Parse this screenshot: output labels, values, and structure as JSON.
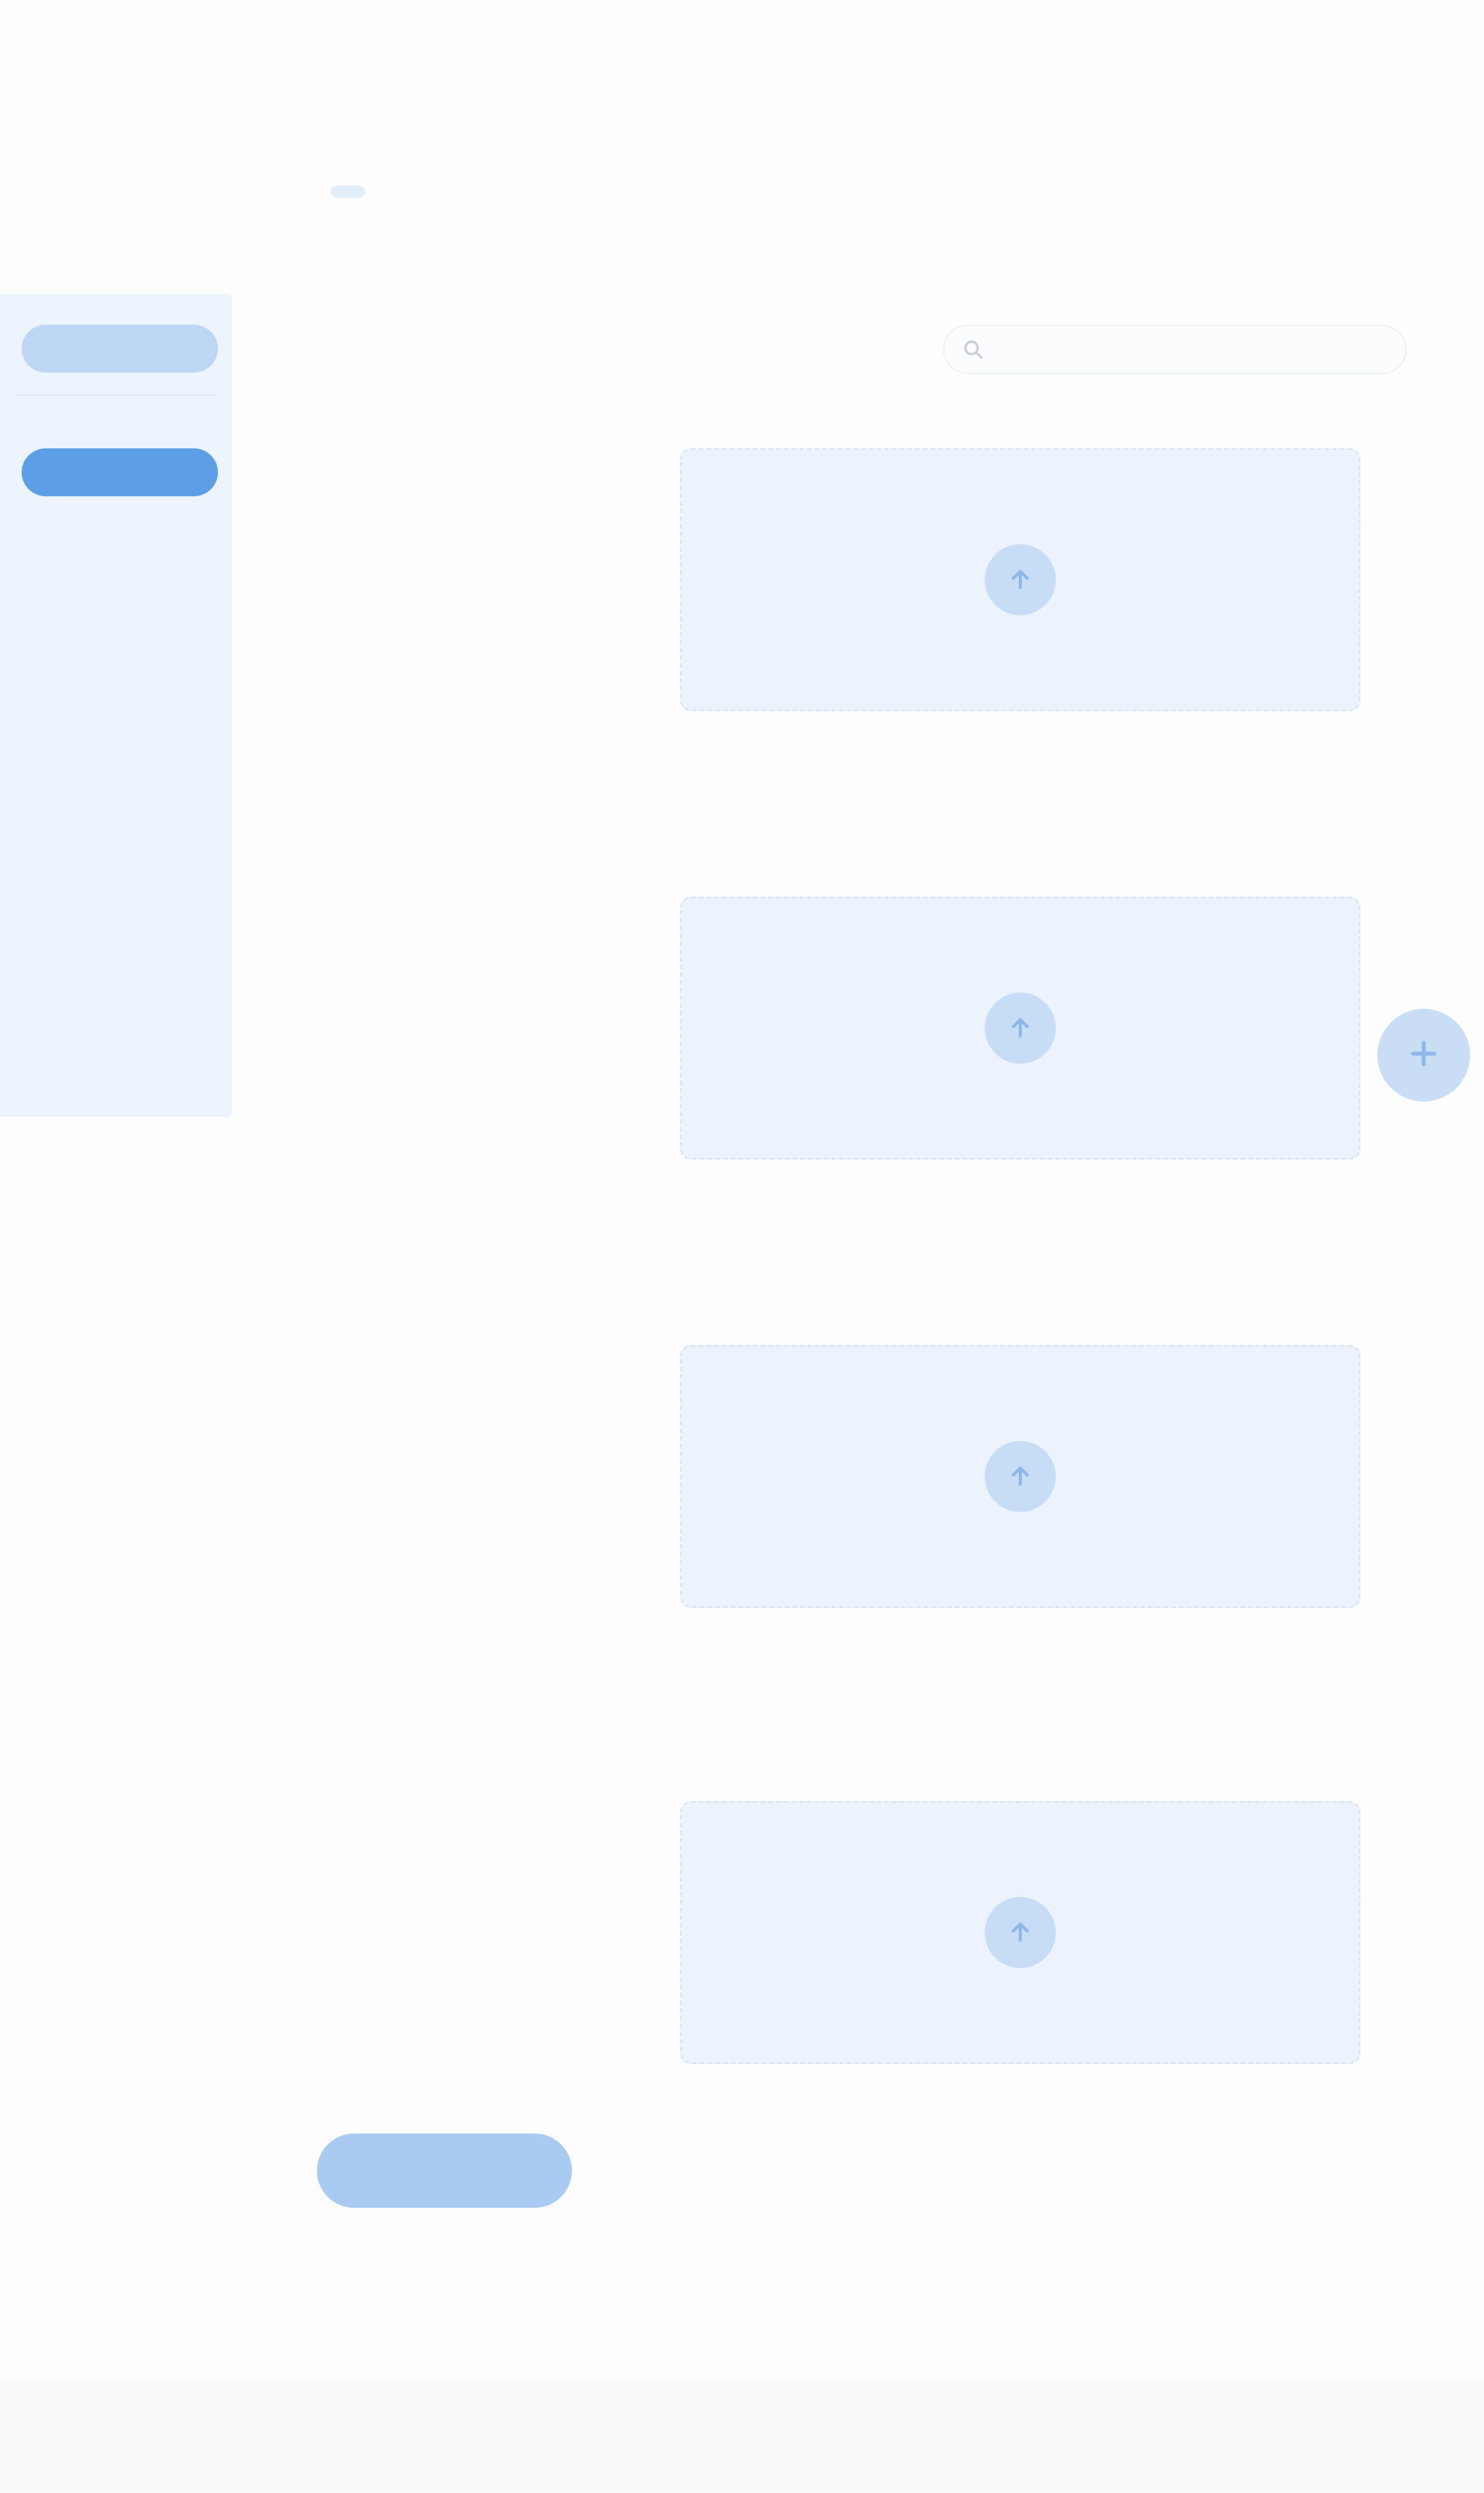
{
  "sidebar": {
    "tabs": [
      {
        "label": ""
      },
      {
        "label": ""
      }
    ],
    "items": [
      {
        "label": ""
      },
      {
        "label": ""
      },
      {
        "label": ""
      },
      {
        "label": ""
      },
      {
        "label": ""
      }
    ]
  },
  "header": {
    "title": "",
    "breadcrumbs": [
      {
        "label": ""
      },
      {
        "label": ""
      },
      {
        "label": ""
      }
    ]
  },
  "main": {
    "section_label": "",
    "search": {
      "placeholder": "",
      "value": ""
    },
    "rows": [
      {
        "title": "",
        "subtitle_lines": [
          "",
          "",
          ""
        ]
      },
      {
        "title": "",
        "subtitle_lines": [
          "",
          "",
          ""
        ]
      },
      {
        "title": "",
        "subtitle_lines": [
          "",
          "",
          ""
        ]
      },
      {
        "title": "",
        "subtitle_lines": [
          "",
          "",
          ""
        ]
      }
    ],
    "submit_label": ""
  },
  "footer": {
    "text": ""
  },
  "icons": {
    "upload": "upload-icon",
    "search": "search-icon",
    "fab": "add-icon"
  },
  "colors": {
    "accent": "#5d9fe6",
    "accent_soft": "#c7dcf5",
    "drop_zone_bg": "#edf3fd",
    "sidebar_bg": "#eef4fd"
  }
}
